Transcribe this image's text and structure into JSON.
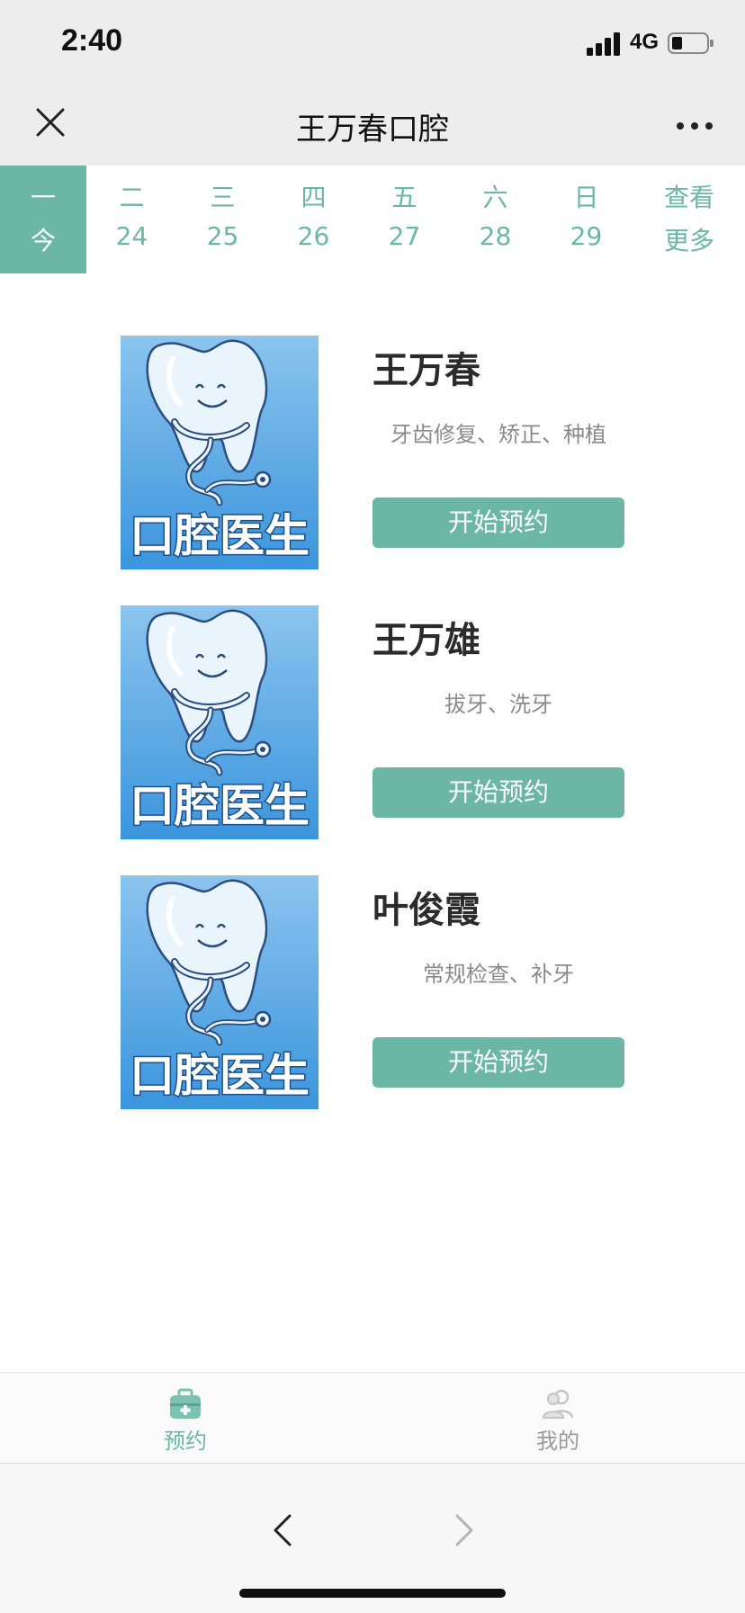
{
  "status": {
    "time": "2:40",
    "network": "4G"
  },
  "nav": {
    "title": "王万春口腔"
  },
  "dates": [
    {
      "weekday": "一",
      "day": "今",
      "active": true
    },
    {
      "weekday": "二",
      "day": "24"
    },
    {
      "weekday": "三",
      "day": "25"
    },
    {
      "weekday": "四",
      "day": "26"
    },
    {
      "weekday": "五",
      "day": "27"
    },
    {
      "weekday": "六",
      "day": "28"
    },
    {
      "weekday": "日",
      "day": "29"
    },
    {
      "weekday": "查看",
      "day": "更多"
    }
  ],
  "doctors": [
    {
      "name": "王万春",
      "specialty": "牙齿修复、矫正、种植",
      "button": "开始预约",
      "photo_caption": "口腔医生"
    },
    {
      "name": "王万雄",
      "specialty": "拔牙、洗牙",
      "button": "开始预约",
      "photo_caption": "口腔医生"
    },
    {
      "name": "叶俊霞",
      "specialty": "常规检查、补牙",
      "button": "开始预约",
      "photo_caption": "口腔医生"
    }
  ],
  "tabs": [
    {
      "label": "预约",
      "icon": "medical-kit-icon",
      "active": true
    },
    {
      "label": "我的",
      "icon": "users-icon",
      "active": false
    }
  ],
  "theme": {
    "accent": "#6cb6a6",
    "inactive": "#9a9a9a"
  }
}
